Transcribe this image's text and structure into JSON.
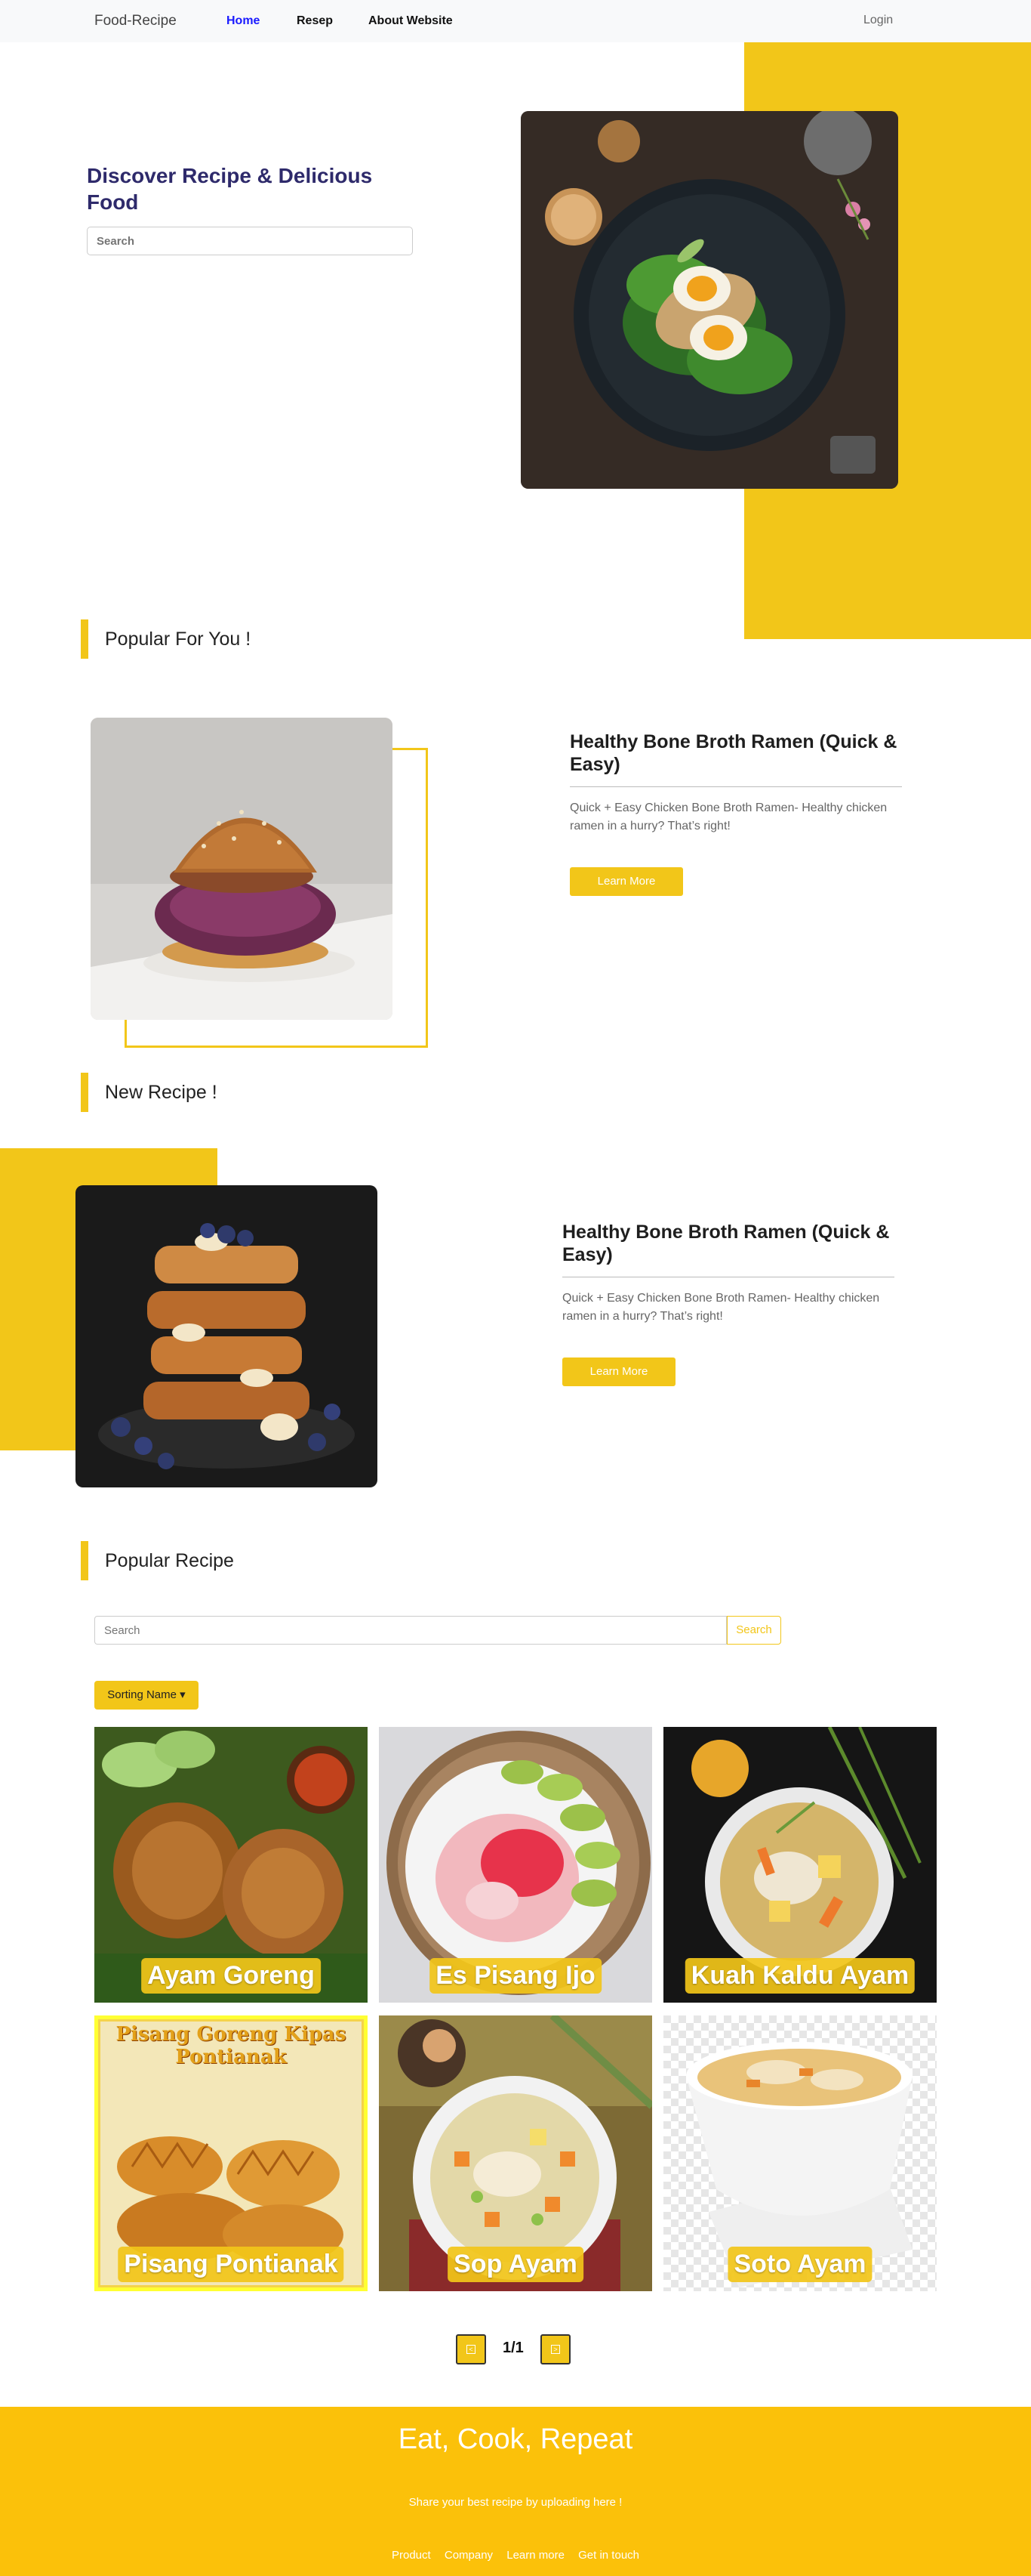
{
  "nav": {
    "brand": "Food-Recipe",
    "links": [
      "Home",
      "Resep",
      "About Website"
    ],
    "login": "Login"
  },
  "hero": {
    "title": "Discover Recipe & Delicious Food",
    "search_placeholder": "Search"
  },
  "sections": {
    "popular_for_you": "Popular For You !",
    "new_recipe": "New Recipe !",
    "popular_recipe": "Popular Recipe"
  },
  "popular_card": {
    "title": "Healthy Bone Broth Ramen (Quick & Easy)",
    "description": "Quick + Easy Chicken Bone Broth Ramen- Healthy chicken ramen in a hurry? That’s right!",
    "button": "Learn More"
  },
  "new_card": {
    "title": "Healthy Bone Broth Ramen (Quick & Easy)",
    "description": "Quick + Easy Chicken Bone Broth Ramen- Healthy chicken ramen in a hurry? That’s right!",
    "button": "Learn More"
  },
  "recipe_search": {
    "placeholder": "Search",
    "button": "Search"
  },
  "sort": {
    "label": "Sorting Name"
  },
  "recipes": [
    {
      "name": "Ayam Goreng"
    },
    {
      "name": "Es Pisang Ijo"
    },
    {
      "name": "Kuah Kaldu Ayam"
    },
    {
      "name": "Pisang Pontianak",
      "poster_text": "Pisang Goreng Kipas Pontianak"
    },
    {
      "name": "Sop Ayam"
    },
    {
      "name": "Soto Ayam"
    }
  ],
  "pagination": {
    "info": "1/1",
    "prev_glyph": "<",
    "next_glyph": ">"
  },
  "footer": {
    "title": "Eat, Cook, Repeat",
    "subtitle": "Share your best recipe by uploading here !",
    "links": [
      "Product",
      "Company",
      "Learn more",
      "Get in touch"
    ]
  },
  "colors": {
    "accent": "#f2c619",
    "footer": "#fbc10a",
    "title": "#2e2a6b",
    "active_link": "#1a1aff"
  }
}
